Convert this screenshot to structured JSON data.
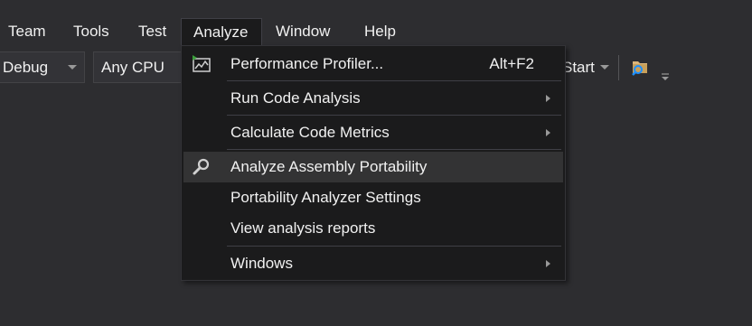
{
  "menubar": {
    "items": [
      {
        "label": "Team"
      },
      {
        "label": "Tools"
      },
      {
        "label": "Test"
      },
      {
        "label": "Analyze"
      },
      {
        "label": "Window"
      },
      {
        "label": "Help"
      }
    ]
  },
  "toolbar": {
    "config": "Debug",
    "platform": "Any CPU",
    "start_label": "Start"
  },
  "analyze_menu": {
    "items": [
      {
        "label": "Performance Profiler...",
        "shortcut": "Alt+F2",
        "icon": "performance-profiler-icon"
      },
      {
        "label": "Run Code Analysis",
        "submenu": true
      },
      {
        "label": "Calculate Code Metrics",
        "submenu": true
      },
      {
        "label": "Analyze Assembly Portability",
        "icon": "magnifier-icon",
        "highlighted": true
      },
      {
        "label": "Portability Analyzer Settings"
      },
      {
        "label": "View analysis reports"
      },
      {
        "label": "Windows",
        "submenu": true
      }
    ]
  },
  "colors": {
    "background": "#2d2d30",
    "menu_background": "#1b1b1c",
    "highlight": "#333334",
    "text": "#f1f1f1"
  }
}
